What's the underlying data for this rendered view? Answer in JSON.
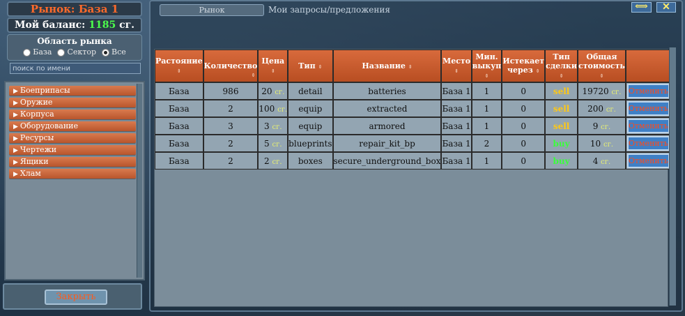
{
  "market": {
    "title": "Рынок: База 1",
    "balance_label": "Мой баланс:",
    "balance_value": "1185",
    "balance_unit": "сг.",
    "area_label": "Область рынка",
    "radio_options": [
      "База",
      "Сектор",
      "Все"
    ],
    "radio_selected": "Все",
    "search_placeholder": "поиск по имени",
    "close_label": "Закрыть"
  },
  "categories": [
    "Боеприпасы",
    "Оружие",
    "Корпуса",
    "Оборудование",
    "Ресурсы",
    "Чертежи",
    "Ящики",
    "Хлам"
  ],
  "tabs": {
    "market": "Рынок",
    "my_requests": "Мои запросы/предложения"
  },
  "window_buttons": {
    "resize_icon": "resize-horizontal-icon",
    "close_icon": "close-x-icon"
  },
  "colors": {
    "accent_orange": "#d86a3c",
    "title_orange": "#ff6a2a",
    "balance_green": "#4cff4c",
    "sell_color": "#ffc814",
    "buy_color": "#3aff3a"
  },
  "table": {
    "headers": [
      {
        "line1": "Растояние",
        "line2": ""
      },
      {
        "line1": "Количество",
        "line2": ""
      },
      {
        "line1": "Цена",
        "line2": ""
      },
      {
        "line1": "Тип",
        "line2": ""
      },
      {
        "line1": "Название",
        "line2": ""
      },
      {
        "line1": "Место",
        "line2": ""
      },
      {
        "line1": "Мин.",
        "line2": "выкуп"
      },
      {
        "line1": "Истекает",
        "line2": "через"
      },
      {
        "line1": "Тип",
        "line2": "сделки"
      },
      {
        "line1": "Общая",
        "line2": "стоимость"
      },
      {
        "line1": "",
        "line2": ""
      }
    ],
    "rows": [
      {
        "distance": "База",
        "qty": "986",
        "price": "20",
        "type": "detail",
        "name": "batteries",
        "place": "База 1",
        "min": "1",
        "expires": "0",
        "deal": "sell",
        "total": "19720",
        "action": "Отменить"
      },
      {
        "distance": "База",
        "qty": "2",
        "price": "100",
        "type": "equip",
        "name": "extracted",
        "place": "База 1",
        "min": "1",
        "expires": "0",
        "deal": "sell",
        "total": "200",
        "action": "Отменить"
      },
      {
        "distance": "База",
        "qty": "3",
        "price": "3",
        "type": "equip",
        "name": "armored",
        "place": "База 1",
        "min": "1",
        "expires": "0",
        "deal": "sell",
        "total": "9",
        "action": "Отменить"
      },
      {
        "distance": "База",
        "qty": "2",
        "price": "5",
        "type": "blueprints",
        "name": "repair_kit_bp",
        "place": "База 1",
        "min": "2",
        "expires": "0",
        "deal": "buy",
        "total": "10",
        "action": "Отменить"
      },
      {
        "distance": "База",
        "qty": "2",
        "price": "2",
        "type": "boxes",
        "name": "secure_underground_box",
        "place": "База 1",
        "min": "1",
        "expires": "0",
        "deal": "buy",
        "total": "4",
        "action": "Отменить"
      }
    ],
    "currency_unit": "сг."
  }
}
